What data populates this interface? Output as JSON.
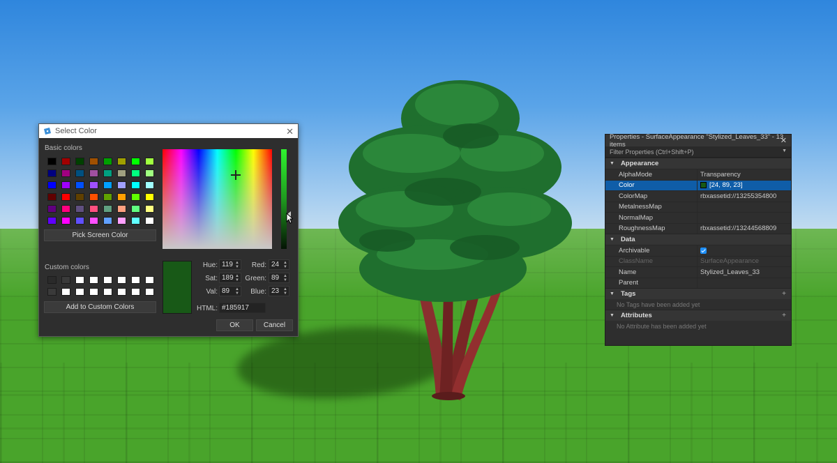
{
  "color_dialog": {
    "title": "Select Color",
    "basic_colors_label": "Basic colors",
    "basic_colors": [
      "#000000",
      "#a00000",
      "#004000",
      "#a05000",
      "#00a000",
      "#a0a000",
      "#00ff00",
      "#a0ff40",
      "#000080",
      "#a00080",
      "#005080",
      "#a050a0",
      "#00a080",
      "#a0a080",
      "#00ff80",
      "#a0ff80",
      "#0000ff",
      "#a000ff",
      "#0050ff",
      "#a050ff",
      "#00a0ff",
      "#a0a0ff",
      "#00ffff",
      "#a0ffff",
      "#600000",
      "#ff0000",
      "#604000",
      "#ff5000",
      "#60a000",
      "#ffa000",
      "#60ff00",
      "#ffff00",
      "#600080",
      "#ff0080",
      "#605080",
      "#ff5080",
      "#60a080",
      "#ffa080",
      "#60ff80",
      "#ffff80",
      "#6000ff",
      "#ff00ff",
      "#6050ff",
      "#ff50ff",
      "#60a0ff",
      "#ffa0ff",
      "#60ffff",
      "#ffffff"
    ],
    "pick_screen_label": "Pick Screen Color",
    "custom_colors_label": "Custom colors",
    "custom_colors": [
      "#2a2a2a",
      "#3a3a3a",
      "#ffffff",
      "#ffffff",
      "#ffffff",
      "#ffffff",
      "#ffffff",
      "#ffffff",
      "#3a3a3a",
      "#ffffff",
      "#ffffff",
      "#ffffff",
      "#ffffff",
      "#ffffff",
      "#ffffff",
      "#ffffff"
    ],
    "add_custom_label": "Add to Custom Colors",
    "selected_color": "#185917",
    "hue_label": "Hue:",
    "hue": "119",
    "sat_label": "Sat:",
    "sat": "189",
    "val_label": "Val:",
    "val": "89",
    "red_label": "Red:",
    "red": "24",
    "green_label": "Green:",
    "green": "89",
    "blue_label": "Blue:",
    "blue": "23",
    "html_label": "HTML:",
    "html": "#185917",
    "ok_label": "OK",
    "cancel_label": "Cancel",
    "luminance_level": 0.35
  },
  "properties": {
    "title": "Properties - SurfaceAppearance \"Stylized_Leaves_33\" - 13 items",
    "filter_placeholder": "Filter Properties (Ctrl+Shift+P)",
    "appearance_label": "Appearance",
    "appearance_rows": [
      {
        "name": "AlphaMode",
        "value": "Transparency"
      },
      {
        "name": "Color",
        "value": "[24, 89, 23]",
        "chip": "#185917",
        "selected": true
      },
      {
        "name": "ColorMap",
        "value": "rbxassetid://13255354800"
      },
      {
        "name": "MetalnessMap",
        "value": ""
      },
      {
        "name": "NormalMap",
        "value": ""
      },
      {
        "name": "RoughnessMap",
        "value": "rbxassetid://13244568809"
      }
    ],
    "data_label": "Data",
    "data_rows": [
      {
        "name": "Archivable",
        "value": "",
        "checkbox": true
      },
      {
        "name": "ClassName",
        "value": "SurfaceAppearance",
        "disabled": true
      },
      {
        "name": "Name",
        "value": "Stylized_Leaves_33"
      },
      {
        "name": "Parent",
        "value": ""
      }
    ],
    "tags_label": "Tags",
    "tags_empty": "No Tags have been added yet",
    "attributes_label": "Attributes",
    "attributes_empty": "No Attribute has been added yet"
  },
  "colors": {
    "selection_blue": "#0f5da8",
    "panel_bg": "#2e2e2e",
    "sky": "#5aa1e6",
    "grass": "#49a42b"
  }
}
